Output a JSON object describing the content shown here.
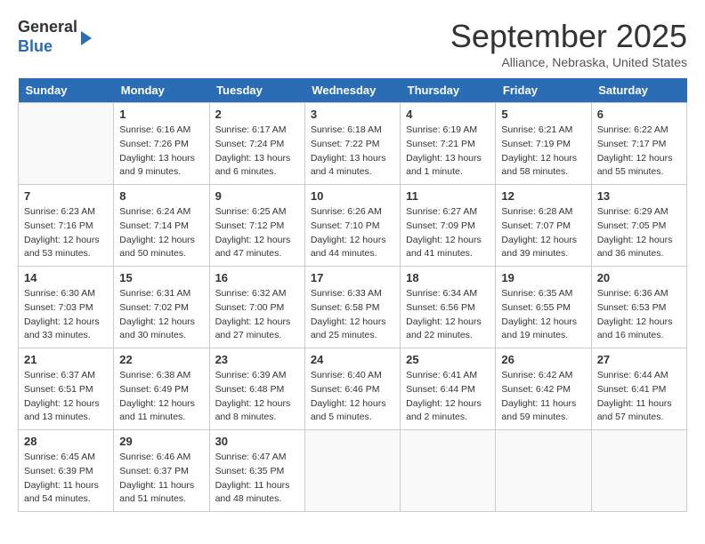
{
  "logo": {
    "line1": "General",
    "line2": "Blue"
  },
  "title": "September 2025",
  "subtitle": "Alliance, Nebraska, United States",
  "weekdays": [
    "Sunday",
    "Monday",
    "Tuesday",
    "Wednesday",
    "Thursday",
    "Friday",
    "Saturday"
  ],
  "weeks": [
    [
      {
        "day": "",
        "info": ""
      },
      {
        "day": "1",
        "info": "Sunrise: 6:16 AM\nSunset: 7:26 PM\nDaylight: 13 hours\nand 9 minutes."
      },
      {
        "day": "2",
        "info": "Sunrise: 6:17 AM\nSunset: 7:24 PM\nDaylight: 13 hours\nand 6 minutes."
      },
      {
        "day": "3",
        "info": "Sunrise: 6:18 AM\nSunset: 7:22 PM\nDaylight: 13 hours\nand 4 minutes."
      },
      {
        "day": "4",
        "info": "Sunrise: 6:19 AM\nSunset: 7:21 PM\nDaylight: 13 hours\nand 1 minute."
      },
      {
        "day": "5",
        "info": "Sunrise: 6:21 AM\nSunset: 7:19 PM\nDaylight: 12 hours\nand 58 minutes."
      },
      {
        "day": "6",
        "info": "Sunrise: 6:22 AM\nSunset: 7:17 PM\nDaylight: 12 hours\nand 55 minutes."
      }
    ],
    [
      {
        "day": "7",
        "info": "Sunrise: 6:23 AM\nSunset: 7:16 PM\nDaylight: 12 hours\nand 53 minutes."
      },
      {
        "day": "8",
        "info": "Sunrise: 6:24 AM\nSunset: 7:14 PM\nDaylight: 12 hours\nand 50 minutes."
      },
      {
        "day": "9",
        "info": "Sunrise: 6:25 AM\nSunset: 7:12 PM\nDaylight: 12 hours\nand 47 minutes."
      },
      {
        "day": "10",
        "info": "Sunrise: 6:26 AM\nSunset: 7:10 PM\nDaylight: 12 hours\nand 44 minutes."
      },
      {
        "day": "11",
        "info": "Sunrise: 6:27 AM\nSunset: 7:09 PM\nDaylight: 12 hours\nand 41 minutes."
      },
      {
        "day": "12",
        "info": "Sunrise: 6:28 AM\nSunset: 7:07 PM\nDaylight: 12 hours\nand 39 minutes."
      },
      {
        "day": "13",
        "info": "Sunrise: 6:29 AM\nSunset: 7:05 PM\nDaylight: 12 hours\nand 36 minutes."
      }
    ],
    [
      {
        "day": "14",
        "info": "Sunrise: 6:30 AM\nSunset: 7:03 PM\nDaylight: 12 hours\nand 33 minutes."
      },
      {
        "day": "15",
        "info": "Sunrise: 6:31 AM\nSunset: 7:02 PM\nDaylight: 12 hours\nand 30 minutes."
      },
      {
        "day": "16",
        "info": "Sunrise: 6:32 AM\nSunset: 7:00 PM\nDaylight: 12 hours\nand 27 minutes."
      },
      {
        "day": "17",
        "info": "Sunrise: 6:33 AM\nSunset: 6:58 PM\nDaylight: 12 hours\nand 25 minutes."
      },
      {
        "day": "18",
        "info": "Sunrise: 6:34 AM\nSunset: 6:56 PM\nDaylight: 12 hours\nand 22 minutes."
      },
      {
        "day": "19",
        "info": "Sunrise: 6:35 AM\nSunset: 6:55 PM\nDaylight: 12 hours\nand 19 minutes."
      },
      {
        "day": "20",
        "info": "Sunrise: 6:36 AM\nSunset: 6:53 PM\nDaylight: 12 hours\nand 16 minutes."
      }
    ],
    [
      {
        "day": "21",
        "info": "Sunrise: 6:37 AM\nSunset: 6:51 PM\nDaylight: 12 hours\nand 13 minutes."
      },
      {
        "day": "22",
        "info": "Sunrise: 6:38 AM\nSunset: 6:49 PM\nDaylight: 12 hours\nand 11 minutes."
      },
      {
        "day": "23",
        "info": "Sunrise: 6:39 AM\nSunset: 6:48 PM\nDaylight: 12 hours\nand 8 minutes."
      },
      {
        "day": "24",
        "info": "Sunrise: 6:40 AM\nSunset: 6:46 PM\nDaylight: 12 hours\nand 5 minutes."
      },
      {
        "day": "25",
        "info": "Sunrise: 6:41 AM\nSunset: 6:44 PM\nDaylight: 12 hours\nand 2 minutes."
      },
      {
        "day": "26",
        "info": "Sunrise: 6:42 AM\nSunset: 6:42 PM\nDaylight: 11 hours\nand 59 minutes."
      },
      {
        "day": "27",
        "info": "Sunrise: 6:44 AM\nSunset: 6:41 PM\nDaylight: 11 hours\nand 57 minutes."
      }
    ],
    [
      {
        "day": "28",
        "info": "Sunrise: 6:45 AM\nSunset: 6:39 PM\nDaylight: 11 hours\nand 54 minutes."
      },
      {
        "day": "29",
        "info": "Sunrise: 6:46 AM\nSunset: 6:37 PM\nDaylight: 11 hours\nand 51 minutes."
      },
      {
        "day": "30",
        "info": "Sunrise: 6:47 AM\nSunset: 6:35 PM\nDaylight: 11 hours\nand 48 minutes."
      },
      {
        "day": "",
        "info": ""
      },
      {
        "day": "",
        "info": ""
      },
      {
        "day": "",
        "info": ""
      },
      {
        "day": "",
        "info": ""
      }
    ]
  ]
}
